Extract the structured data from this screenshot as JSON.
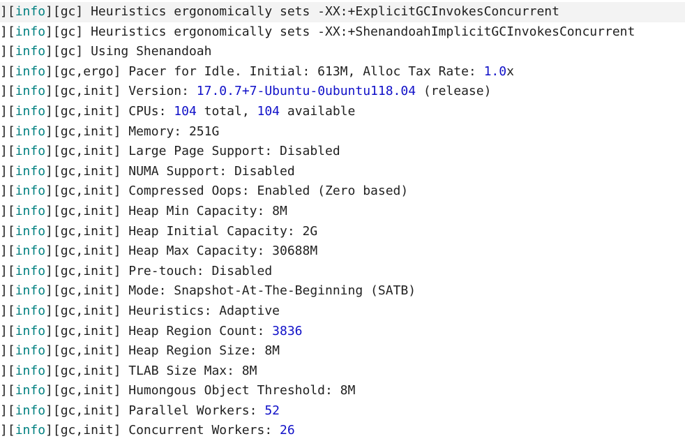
{
  "lines": [
    {
      "segs": [
        {
          "t": "]["
        },
        {
          "t": "info",
          "c": "lvl"
        },
        {
          "t": "][gc] Heuristics ergonomically sets -XX:+ExplicitGCInvokesConcurrent"
        }
      ]
    },
    {
      "segs": [
        {
          "t": "]["
        },
        {
          "t": "info",
          "c": "lvl"
        },
        {
          "t": "][gc] Heuristics ergonomically sets -XX:+ShenandoahImplicitGCInvokesConcurrent"
        }
      ]
    },
    {
      "segs": [
        {
          "t": "]["
        },
        {
          "t": "info",
          "c": "lvl"
        },
        {
          "t": "][gc] Using Shenandoah"
        }
      ]
    },
    {
      "segs": [
        {
          "t": "]["
        },
        {
          "t": "info",
          "c": "lvl"
        },
        {
          "t": "][gc,ergo] Pacer for Idle. Initial: 613M, Alloc Tax Rate: "
        },
        {
          "t": "1.0",
          "c": "num"
        },
        {
          "t": "x"
        }
      ]
    },
    {
      "segs": [
        {
          "t": "]["
        },
        {
          "t": "info",
          "c": "lvl"
        },
        {
          "t": "][gc,init] Version: "
        },
        {
          "t": "17.0.7+7-Ubuntu-0ubuntu118.04",
          "c": "num"
        },
        {
          "t": " (release)"
        }
      ]
    },
    {
      "segs": [
        {
          "t": "]["
        },
        {
          "t": "info",
          "c": "lvl"
        },
        {
          "t": "][gc,init] CPUs: "
        },
        {
          "t": "104",
          "c": "num"
        },
        {
          "t": " total, "
        },
        {
          "t": "104",
          "c": "num"
        },
        {
          "t": " available"
        }
      ]
    },
    {
      "segs": [
        {
          "t": "]["
        },
        {
          "t": "info",
          "c": "lvl"
        },
        {
          "t": "][gc,init] Memory: 251G"
        }
      ]
    },
    {
      "segs": [
        {
          "t": "]["
        },
        {
          "t": "info",
          "c": "lvl"
        },
        {
          "t": "][gc,init] Large Page Support: Disabled"
        }
      ]
    },
    {
      "segs": [
        {
          "t": "]["
        },
        {
          "t": "info",
          "c": "lvl"
        },
        {
          "t": "][gc,init] NUMA Support: Disabled"
        }
      ]
    },
    {
      "segs": [
        {
          "t": "]["
        },
        {
          "t": "info",
          "c": "lvl"
        },
        {
          "t": "][gc,init] Compressed Oops: Enabled (Zero based)"
        }
      ]
    },
    {
      "segs": [
        {
          "t": "]["
        },
        {
          "t": "info",
          "c": "lvl"
        },
        {
          "t": "][gc,init] Heap Min Capacity: 8M"
        }
      ]
    },
    {
      "segs": [
        {
          "t": "]["
        },
        {
          "t": "info",
          "c": "lvl"
        },
        {
          "t": "][gc,init] Heap Initial Capacity: 2G"
        }
      ]
    },
    {
      "segs": [
        {
          "t": "]["
        },
        {
          "t": "info",
          "c": "lvl"
        },
        {
          "t": "][gc,init] Heap Max Capacity: 30688M"
        }
      ]
    },
    {
      "segs": [
        {
          "t": "]["
        },
        {
          "t": "info",
          "c": "lvl"
        },
        {
          "t": "][gc,init] Pre-touch: Disabled"
        }
      ]
    },
    {
      "segs": [
        {
          "t": "]["
        },
        {
          "t": "info",
          "c": "lvl"
        },
        {
          "t": "][gc,init] Mode: Snapshot-At-The-Beginning (SATB)"
        }
      ]
    },
    {
      "segs": [
        {
          "t": "]["
        },
        {
          "t": "info",
          "c": "lvl"
        },
        {
          "t": "][gc,init] Heuristics: Adaptive"
        }
      ]
    },
    {
      "segs": [
        {
          "t": "]["
        },
        {
          "t": "info",
          "c": "lvl"
        },
        {
          "t": "][gc,init] Heap Region Count: "
        },
        {
          "t": "3836",
          "c": "num"
        }
      ]
    },
    {
      "segs": [
        {
          "t": "]["
        },
        {
          "t": "info",
          "c": "lvl"
        },
        {
          "t": "][gc,init] Heap Region Size: 8M"
        }
      ]
    },
    {
      "segs": [
        {
          "t": "]["
        },
        {
          "t": "info",
          "c": "lvl"
        },
        {
          "t": "][gc,init] TLAB Size Max: 8M"
        }
      ]
    },
    {
      "segs": [
        {
          "t": "]["
        },
        {
          "t": "info",
          "c": "lvl"
        },
        {
          "t": "][gc,init] Humongous Object Threshold: 8M"
        }
      ]
    },
    {
      "segs": [
        {
          "t": "]["
        },
        {
          "t": "info",
          "c": "lvl"
        },
        {
          "t": "][gc,init] Parallel Workers: "
        },
        {
          "t": "52",
          "c": "num"
        }
      ]
    },
    {
      "segs": [
        {
          "t": "]["
        },
        {
          "t": "info",
          "c": "lvl"
        },
        {
          "t": "][gc,init] Concurrent Workers: "
        },
        {
          "t": "26",
          "c": "num"
        }
      ]
    }
  ],
  "colors": {
    "text": "#1f1f1f",
    "level": "#008080",
    "number": "#1010c8",
    "highlight_row": "#f3f3f3"
  }
}
